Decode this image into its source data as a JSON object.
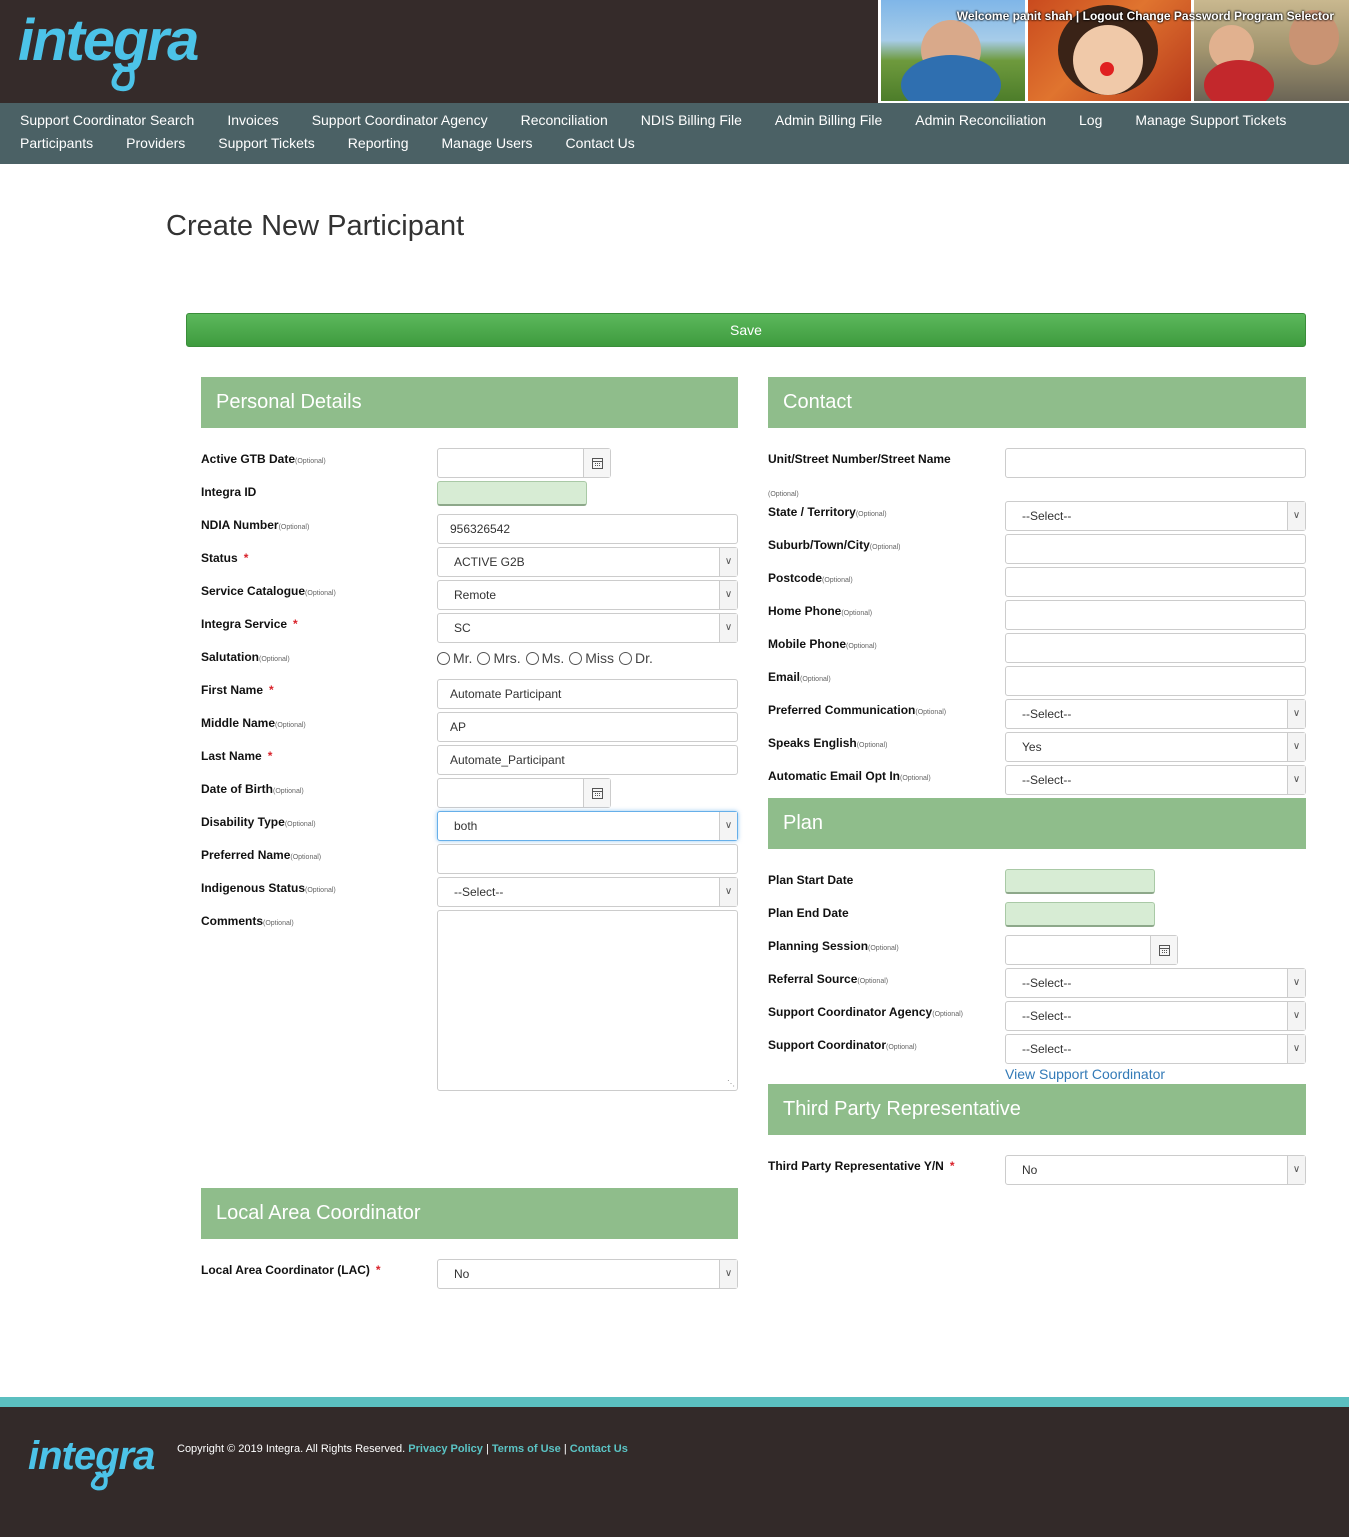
{
  "header": {
    "logo_text": "integra",
    "welcome": "Welcome panit shah | Logout Change Password Program Selector"
  },
  "nav": {
    "row1": [
      "Support Coordinator Search",
      "Invoices",
      "Support Coordinator Agency",
      "Reconciliation",
      "NDIS Billing File",
      "Admin Billing File",
      "Admin Reconciliation",
      "Log",
      "Manage Support Tickets"
    ],
    "row2": [
      "Participants",
      "Providers",
      "Support Tickets",
      "Reporting",
      "Manage Users",
      "Contact Us"
    ]
  },
  "page": {
    "title": "Create New Participant",
    "save_label": "Save"
  },
  "optional_tag": "(Optional)",
  "personal": {
    "heading": "Personal Details",
    "active_gtb_date": {
      "label": "Active GTB Date",
      "value": ""
    },
    "integra_id": {
      "label": "Integra ID",
      "value": ""
    },
    "ndia_number": {
      "label": "NDIA Number",
      "value": "956326542"
    },
    "status": {
      "label": "Status",
      "value": "ACTIVE G2B"
    },
    "service_catalogue": {
      "label": "Service Catalogue",
      "value": "Remote"
    },
    "integra_service": {
      "label": "Integra Service",
      "value": "SC"
    },
    "salutation": {
      "label": "Salutation",
      "options": [
        "Mr.",
        "Mrs.",
        "Ms.",
        "Miss",
        "Dr."
      ]
    },
    "first_name": {
      "label": "First Name",
      "value": "Automate Participant"
    },
    "middle_name": {
      "label": "Middle Name",
      "value": "AP"
    },
    "last_name": {
      "label": "Last Name",
      "value": "Automate_Participant"
    },
    "dob": {
      "label": "Date of Birth",
      "value": ""
    },
    "disability_type": {
      "label": "Disability Type",
      "value": "both"
    },
    "preferred_name": {
      "label": "Preferred Name",
      "value": ""
    },
    "indigenous_status": {
      "label": "Indigenous Status",
      "value": "--Select--"
    },
    "comments": {
      "label": "Comments",
      "value": ""
    }
  },
  "contact": {
    "heading": "Contact",
    "street": {
      "label": "Unit/Street Number/Street Name",
      "value": ""
    },
    "state": {
      "label": "State / Territory",
      "value": "--Select--"
    },
    "suburb": {
      "label": "Suburb/Town/City",
      "value": ""
    },
    "postcode": {
      "label": "Postcode",
      "value": ""
    },
    "home_phone": {
      "label": "Home Phone",
      "value": ""
    },
    "mobile_phone": {
      "label": "Mobile Phone",
      "value": ""
    },
    "email": {
      "label": "Email",
      "value": ""
    },
    "pref_comm": {
      "label": "Preferred Communication",
      "value": "--Select--"
    },
    "speaks_english": {
      "label": "Speaks English",
      "value": "Yes"
    },
    "auto_email": {
      "label": "Automatic Email Opt In",
      "value": "--Select--"
    }
  },
  "plan": {
    "heading": "Plan",
    "start_date": {
      "label": "Plan Start Date",
      "value": ""
    },
    "end_date": {
      "label": "Plan End Date",
      "value": ""
    },
    "planning_session": {
      "label": "Planning Session",
      "value": ""
    },
    "referral_source": {
      "label": "Referral Source",
      "value": "--Select--"
    },
    "sc_agency": {
      "label": "Support Coordinator Agency",
      "value": "--Select--"
    },
    "sc": {
      "label": "Support Coordinator",
      "value": "--Select--"
    },
    "view_sc_link": "View Support Coordinator"
  },
  "tpr": {
    "heading": "Third Party Representative",
    "yn": {
      "label": "Third Party Representative Y/N",
      "value": "No"
    }
  },
  "lac": {
    "heading": "Local Area Coordinator",
    "lac": {
      "label": "Local Area Coordinator (LAC)",
      "value": "No"
    }
  },
  "footer": {
    "copyright": "Copyright © 2019 Integra. All Rights Reserved.",
    "privacy": "Privacy Policy",
    "terms": "Terms of Use",
    "contact": "Contact Us",
    "sep": "|"
  },
  "colors": {
    "header_bg": "#352b2a",
    "nav_bg": "#4b6165",
    "section_green": "#8fbd8b",
    "save_green": "#4cae4c",
    "footer_accent": "#5bbfc0"
  }
}
